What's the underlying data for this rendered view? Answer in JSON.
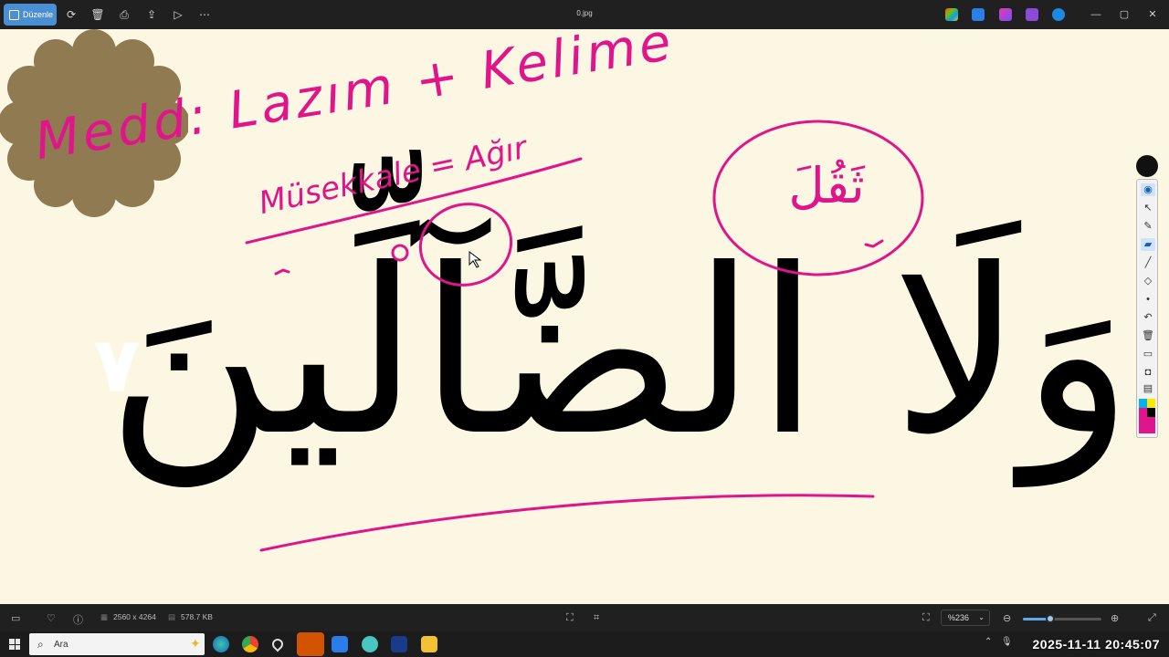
{
  "toolbar": {
    "edit_label": "Düzenle",
    "filename": "0.jpg",
    "window_controls": [
      "—",
      "▢",
      "✕"
    ]
  },
  "image": {
    "arabic_main": "وَلَا الضَّآلِّينَ",
    "ayah_number": "٧",
    "note_line_1": "Medd: Lazım + Kelime",
    "note_line_2": "Müsekkale = Ağır",
    "arabic_note": "ثَقُلَ",
    "colors": {
      "ink": "#e0158c",
      "badge": "#8f7a52",
      "paper": "#fcf7e2"
    }
  },
  "status": {
    "dimensions": "2560 x 4264",
    "file_size": "578.7 KB",
    "zoom": "%236",
    "zoom_level_fraction": 0.35
  },
  "taskbar": {
    "search_placeholder": "Ara",
    "clock": "2025-11-11  20:45:07"
  }
}
